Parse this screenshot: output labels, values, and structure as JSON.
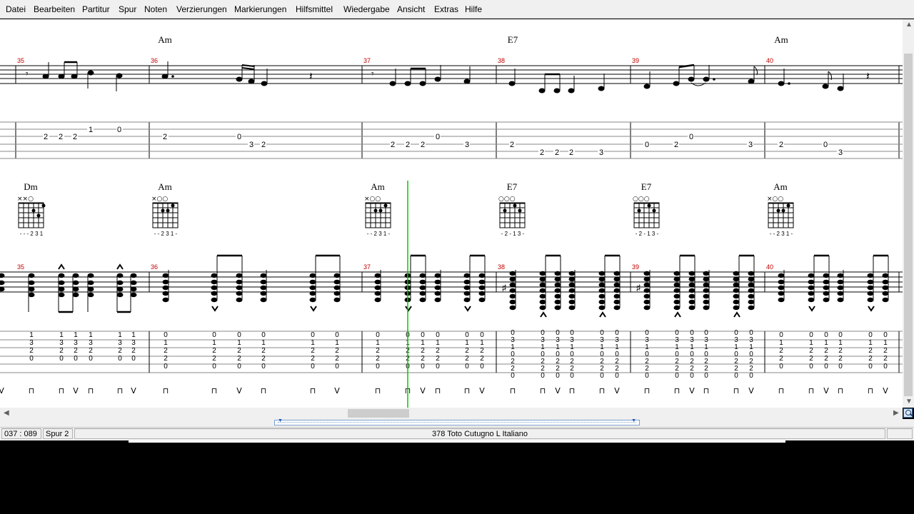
{
  "menu": [
    "Datei",
    "Bearbeiten",
    "Partitur",
    "Spur",
    "Noten",
    "Verzierungen",
    "Markierungen",
    "Hilfsmittel",
    "Wiedergabe",
    "Ansicht",
    "Extras",
    "Hilfe"
  ],
  "system1": {
    "chords": [
      "Am",
      "E7",
      "Am"
    ],
    "measures": [
      "35",
      "36",
      "37",
      "38",
      "39",
      "40"
    ],
    "tab": {
      "m35": [
        "2",
        "2",
        "2",
        "1",
        "0"
      ],
      "m36": [
        "2",
        "0",
        "3",
        "2"
      ],
      "m37": [
        "2",
        "2",
        "2",
        "0",
        "3"
      ],
      "m38": [
        "2",
        "2",
        "2",
        "2",
        "3"
      ],
      "m39": [
        "0",
        "2",
        "0",
        "3"
      ],
      "m40": [
        "2",
        "0",
        "3"
      ]
    }
  },
  "system2": {
    "chords": [
      "Dm",
      "Am",
      "Am",
      "E7",
      "E7",
      "Am"
    ],
    "chord_fingerings": [
      "- - - 2 3 1",
      "- - 2 3 1 -",
      "- - 2 3 1 -",
      "- 2 - 1 3 -",
      "- 2 - 1 3 -",
      "- - 2 3 1 -"
    ],
    "muted_marks": [
      "××○",
      "×○○",
      "×○○",
      "○○○",
      "○○○",
      "×○○"
    ],
    "measures": [
      "35",
      "36",
      "37",
      "38",
      "39",
      "40"
    ],
    "tab_columns": {
      "am": [
        "0",
        "1",
        "2",
        "2",
        "0"
      ],
      "dm": [
        "1",
        "3",
        "2",
        "0"
      ],
      "e7": [
        "0",
        "3",
        "1",
        "0",
        "2",
        "2",
        "0"
      ]
    },
    "strums": [
      "⊓",
      "V"
    ]
  },
  "status": {
    "position": "037 : 089",
    "track": "Spur 2",
    "song": "378  Toto Cutugno   L Italiano"
  },
  "colors": {
    "cursor": "#00c800",
    "measure_number": "#c00000",
    "menubar": "#f0f0f0"
  }
}
